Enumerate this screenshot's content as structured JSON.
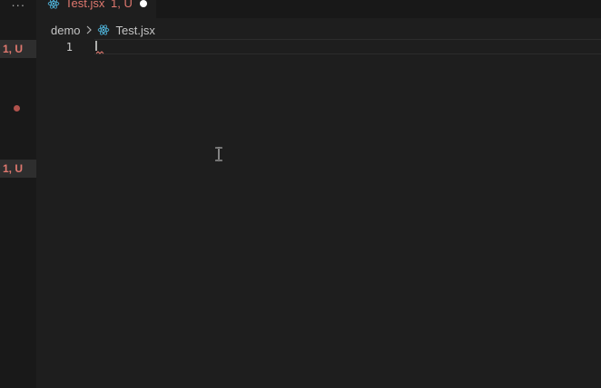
{
  "sidebar": {
    "more_label": "···",
    "badges": [
      {
        "label": "1, U"
      },
      {
        "label": "1, U"
      }
    ]
  },
  "tab": {
    "icon": "react-icon",
    "filename": "Test.jsx",
    "status": "1, U",
    "dirty_indicator": "unsaved-dot"
  },
  "breadcrumb": {
    "folder": "demo",
    "separator_icon": "chevron-right-icon",
    "file_icon": "react-icon",
    "file": "Test.jsx"
  },
  "editor": {
    "line_numbers": [
      "1"
    ]
  },
  "colors": {
    "error": "#e0786f",
    "react_blue": "#4fb3d9",
    "background": "#1e1e1e",
    "sidebar": "#191919"
  }
}
